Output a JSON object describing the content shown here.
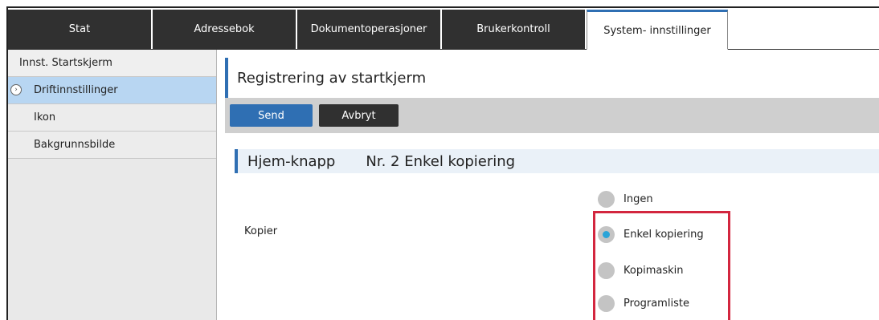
{
  "tabs": [
    {
      "label": "Stat",
      "active": false
    },
    {
      "label": "Adressebok",
      "active": false
    },
    {
      "label": "Dokumentoperasjoner",
      "active": false
    },
    {
      "label": "Brukerkontroll",
      "active": false
    },
    {
      "label": "System- innstillinger",
      "active": true
    }
  ],
  "sidebar": {
    "header": "Innst. Startskjerm",
    "items": [
      {
        "label": "Driftinnstillinger",
        "selected": true
      },
      {
        "label": "Ikon",
        "selected": false
      },
      {
        "label": "Bakgrunnsbilde",
        "selected": false
      }
    ]
  },
  "page": {
    "title": "Registrering av startkjerm",
    "send_label": "Send",
    "cancel_label": "Avbryt"
  },
  "section": {
    "name": "Hjem-knapp",
    "detail": "Nr. 2 Enkel kopiering"
  },
  "field": {
    "label": "Kopier",
    "options": [
      {
        "label": "Ingen",
        "checked": false
      },
      {
        "label": "Enkel kopiering",
        "checked": true
      },
      {
        "label": "Kopimaskin",
        "checked": false
      },
      {
        "label": "Programliste",
        "checked": false
      }
    ]
  },
  "colors": {
    "accent": "#2f6fb3",
    "radio_selected": "#2aa4d8",
    "highlight": "#d3263f",
    "tab_dark": "#303030"
  }
}
